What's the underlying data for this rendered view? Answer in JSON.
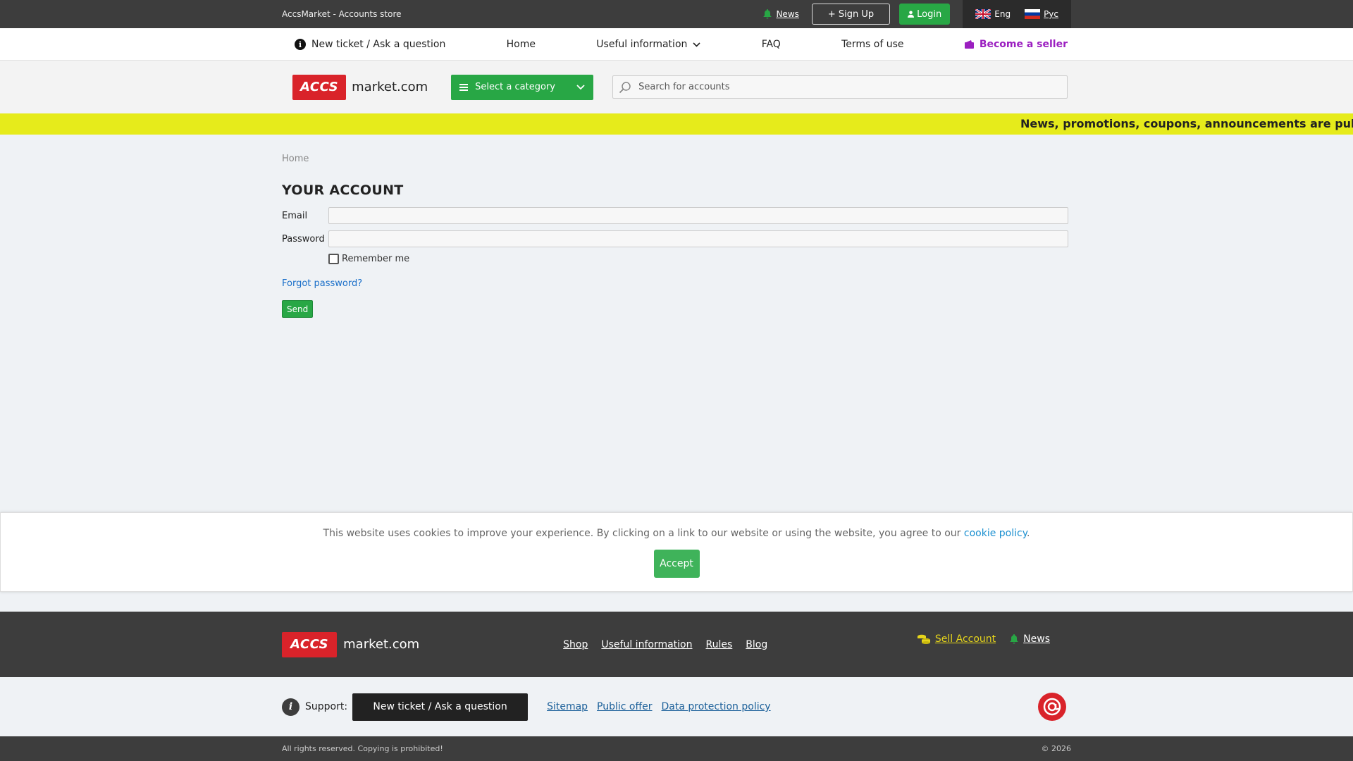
{
  "topbar": {
    "site_name": "AccsMarket - Accounts store",
    "news_label": "News",
    "signup_label": "+ Sign Up",
    "login_label": "Login",
    "languages": [
      {
        "label": "Eng",
        "icon": "uk-flag-icon"
      },
      {
        "label": "Рус",
        "icon": "ru-flag-icon"
      }
    ]
  },
  "nav": {
    "ticket_label": "New ticket / Ask a question",
    "home_label": "Home",
    "useful_label": "Useful information",
    "faq_label": "FAQ",
    "terms_label": "Terms of use",
    "seller_label": "Become a seller"
  },
  "header": {
    "logo_badge": "ACCS",
    "logo_text": "market.com",
    "category_label": "Select a category",
    "search_placeholder": "Search for accounts"
  },
  "ticker": {
    "text": "News, promotions, coupons, announcements are published on"
  },
  "content": {
    "breadcrumb": "Home",
    "title": "YOUR ACCOUNT",
    "email_label": "Email",
    "email_value": "",
    "password_label": "Password",
    "password_value": "",
    "remember_label": "Remember me",
    "remember_checked": false,
    "forgot_label": "Forgot password?",
    "send_label": "Send"
  },
  "cookie": {
    "text": "This website uses cookies to improve your experience. By clicking on a link to our website or using the website, you agree to our",
    "link": "cookie policy",
    "period": ".",
    "accept_label": "Accept"
  },
  "footer": {
    "logo_badge": "ACCS",
    "logo_text": "market.com",
    "links": [
      "Shop",
      "Useful information",
      "Rules",
      "Blog"
    ],
    "sell_label": "Sell Account",
    "news_label": "News",
    "support_label": "Support:",
    "ticket_label": "New ticket / Ask a question",
    "bottom_links": [
      "Sitemap",
      "Public offer",
      "Data protection policy"
    ],
    "rights": "All rights reserved. Copying is prohibited!",
    "copyright": "© 2026"
  },
  "colors": {
    "accent_green": "#28a745",
    "brand_red": "#d9232a",
    "ticker_yellow": "#e6eb1b",
    "seller_purple": "#9b1fc0",
    "dark_bar": "#3d3d3d"
  }
}
